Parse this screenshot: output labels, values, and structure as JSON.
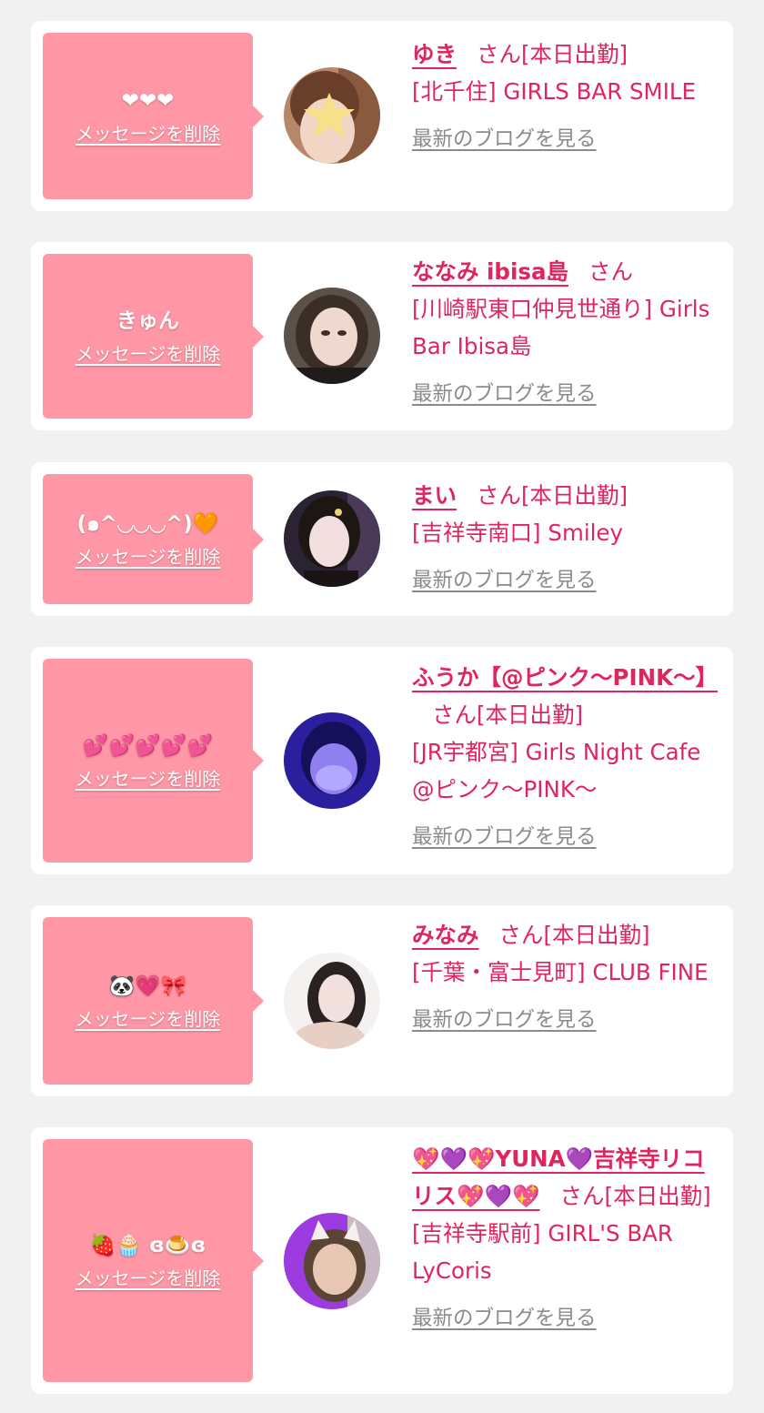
{
  "cards": [
    {
      "message": "❤❤❤",
      "delete_label": "メッセージを削除",
      "avatar": "avatar-photo",
      "name": "ゆき",
      "san": "さん",
      "status": "[本日出勤]",
      "shop": "[北千住] GIRLS BAR SMILE",
      "blog_label": "最新のブログを見る"
    },
    {
      "message": "きゅん",
      "delete_label": "メッセージを削除",
      "avatar": "avatar-photo",
      "name": "ななみ ibisa島",
      "san": "さん",
      "status": "",
      "shop": "[川崎駅東口仲見世通り] Girls Bar Ibisa島",
      "blog_label": "最新のブログを見る"
    },
    {
      "message": "(๑^◡◡◡^)🧡",
      "delete_label": "メッセージを削除",
      "avatar": "avatar-photo",
      "name": "まい",
      "san": "さん",
      "status": "[本日出勤]",
      "shop": "[吉祥寺南口] Smiley",
      "blog_label": "最新のブログを見る"
    },
    {
      "message": "💕💕💕💕💕",
      "delete_label": "メッセージを削除",
      "avatar": "avatar-photo",
      "name": "ふうか【@ピンク〜PINK〜】",
      "san": "さん",
      "status": "[本日出勤]",
      "shop": "[JR宇都宮] Girls Night Cafe @ピンク〜PINK〜",
      "blog_label": "最新のブログを見る"
    },
    {
      "message": "🐼💗🎀",
      "delete_label": "メッセージを削除",
      "avatar": "avatar-photo",
      "name": "みなみ",
      "san": "さん",
      "status": "[本日出勤]",
      "shop": "[千葉・富士見町] CLUB FINE",
      "blog_label": "最新のブログを見る"
    },
    {
      "message": "🍓🧁 ɞ🍮ɞ",
      "delete_label": "メッセージを削除",
      "avatar": "avatar-photo",
      "name": "💖💜💖YUNA💜吉祥寺リコリス💖💜💖",
      "san": "さん",
      "status": "[本日出勤]",
      "shop": "[吉祥寺駅前] GIRL'S BAR LyCoris",
      "blog_label": "最新のブログを見る"
    }
  ],
  "colors": {
    "page_bg": "#f1f1f1",
    "card_bg": "#ffffff",
    "message_bg": "#ff97a6",
    "accent": "#e0245e",
    "link_gray": "#8b8b8b"
  }
}
